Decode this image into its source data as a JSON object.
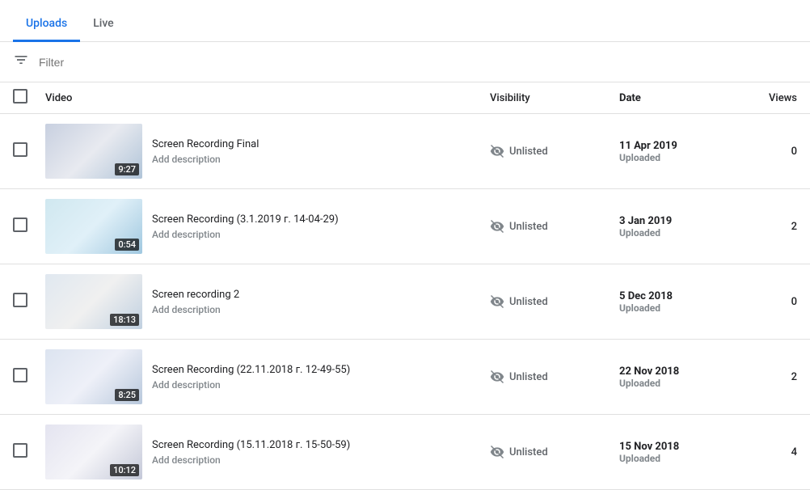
{
  "tabs": [
    {
      "id": "uploads",
      "label": "Uploads",
      "active": true
    },
    {
      "id": "live",
      "label": "Live",
      "active": false
    }
  ],
  "filter": {
    "placeholder": "Filter",
    "value": ""
  },
  "table": {
    "headers": {
      "video": "Video",
      "visibility": "Visibility",
      "date": "Date",
      "views": "Views"
    },
    "rows": [
      {
        "id": 1,
        "title": "Screen Recording Final",
        "description": "Add description",
        "visibility": "Unlisted",
        "date": "11 Apr 2019",
        "date_status": "Uploaded",
        "views": "0",
        "duration": "9:27",
        "thumb_class": "thumb-1"
      },
      {
        "id": 2,
        "title": "Screen Recording (3.1.2019 г. 14-04-29)",
        "description": "Add description",
        "visibility": "Unlisted",
        "date": "3 Jan 2019",
        "date_status": "Uploaded",
        "views": "2",
        "duration": "0:54",
        "thumb_class": "thumb-2"
      },
      {
        "id": 3,
        "title": "Screen recording 2",
        "description": "Add description",
        "visibility": "Unlisted",
        "date": "5 Dec 2018",
        "date_status": "Uploaded",
        "views": "0",
        "duration": "18:13",
        "thumb_class": "thumb-3"
      },
      {
        "id": 4,
        "title": "Screen Recording (22.11.2018 г. 12-49-55)",
        "description": "Add description",
        "visibility": "Unlisted",
        "date": "22 Nov 2018",
        "date_status": "Uploaded",
        "views": "2",
        "duration": "8:25",
        "thumb_class": "thumb-4"
      },
      {
        "id": 5,
        "title": "Screen Recording (15.11.2018 г. 15-50-59)",
        "description": "Add description",
        "visibility": "Unlisted",
        "date": "15 Nov 2018",
        "date_status": "Uploaded",
        "views": "4",
        "duration": "10:12",
        "thumb_class": "thumb-5"
      }
    ]
  }
}
